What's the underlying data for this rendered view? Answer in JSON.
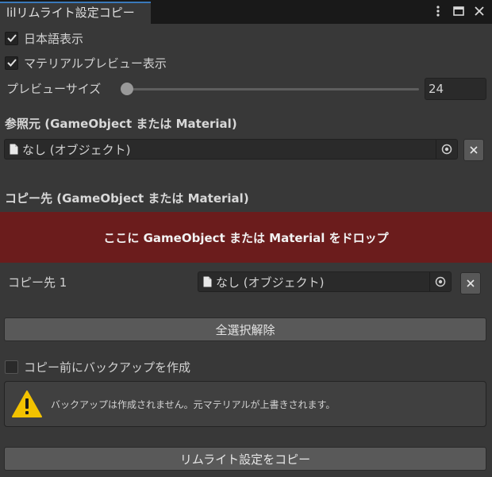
{
  "window": {
    "tab_title": "lilリムライト設定コピー",
    "icons": [
      "more-vert-icon",
      "maximize-icon",
      "close-icon"
    ]
  },
  "options": {
    "japanese_label": "日本語表示",
    "japanese_checked": true,
    "material_preview_label": "マテリアルプレビュー表示",
    "material_preview_checked": true,
    "preview_size_label": "プレビューサイズ",
    "preview_size_value": "24"
  },
  "source": {
    "title": "参照元 (GameObject または Material)",
    "field_value": "なし (オブジェクト)"
  },
  "destination": {
    "title": "コピー先 (GameObject または Material)",
    "drop_text": "ここに GameObject または Material をドロップ",
    "items": [
      {
        "label": "コピー先 1",
        "value": "なし (オブジェクト)"
      }
    ]
  },
  "actions": {
    "deselect_all_label": "全選択解除",
    "backup_label": "コピー前にバックアップを作成",
    "backup_checked": false,
    "warning_text": "バックアップは作成されません。元マテリアルが上書きされます。",
    "copy_button_label": "リムライト設定をコピー"
  },
  "colors": {
    "accent": "#3a79bb",
    "drop_zone": "#6b1c1c",
    "warning": "#f2c200"
  }
}
